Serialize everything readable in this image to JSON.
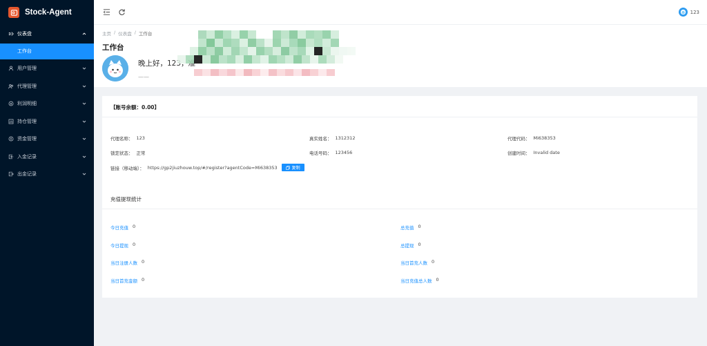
{
  "app": {
    "name": "Stock-Agent"
  },
  "sidebar": {
    "items": [
      {
        "label": "仪表盘",
        "icon": "dashboard-icon"
      },
      {
        "label": "工作台"
      },
      {
        "label": "用户管理",
        "icon": "user-icon"
      },
      {
        "label": "代理管理",
        "icon": "agent-icon"
      },
      {
        "label": "利润明细",
        "icon": "profit-icon"
      },
      {
        "label": "持仓管理",
        "icon": "position-icon"
      },
      {
        "label": "资金管理",
        "icon": "fund-icon"
      },
      {
        "label": "入金记录",
        "icon": "deposit-icon"
      },
      {
        "label": "出金记录",
        "icon": "withdraw-icon"
      }
    ]
  },
  "header": {
    "username": "123"
  },
  "breadcrumb": [
    "主页",
    "/",
    "仪表盘",
    "/",
    "工作台"
  ],
  "page": {
    "title": "工作台",
    "greeting": "晚上好，123，",
    "greeting_partial": "准",
    "sub_greeting": "——"
  },
  "account": {
    "balance_label": "【账号余额：0.00】",
    "fields": {
      "agent_name_label": "代理名称：",
      "agent_name": "123",
      "real_name_label": "真实姓名：",
      "real_name": "1312312",
      "agent_code_label": "代理代码：",
      "agent_code": "Mi638353",
      "lock_status_label": "锁定状态：",
      "lock_status": "正常",
      "phone_label": "电话号码：",
      "phone": "123456",
      "created_label": "创建时间：",
      "created": "Invalid date",
      "link_label": "链接（移动端）：",
      "link": "https://gp2jiuzhouw.top/#/register?agentCode=Mi638353",
      "copy_label": "复制"
    }
  },
  "stats": {
    "title": "充值提现统计",
    "items": [
      {
        "label": "今日充值",
        "value": "0"
      },
      {
        "label": "总充值",
        "value": "0"
      },
      {
        "label": "今日提现",
        "value": "0"
      },
      {
        "label": "总提现",
        "value": "0"
      },
      {
        "label": "当日注册人数",
        "value": "0"
      },
      {
        "label": "当日首充人数",
        "value": "0"
      },
      {
        "label": "当日首充金额",
        "value": "0"
      },
      {
        "label": "当日充值总人数",
        "value": "0"
      }
    ]
  },
  "colors": {
    "sidebar_bg": "#001529",
    "accent": "#1890ff",
    "brand": "#e4572e"
  }
}
